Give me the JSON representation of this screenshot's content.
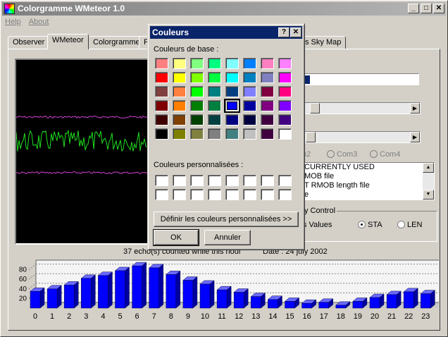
{
  "window": {
    "title": "Colorgramme WMeteor 1.0"
  },
  "menu": [
    "Help",
    "About"
  ],
  "tabs": [
    "Observer",
    "WMeteor",
    "Colorgramme",
    "F",
    "s Sky Map"
  ],
  "com_ports": [
    "m2",
    "Com3",
    "Com4"
  ],
  "listbox": {
    "lines": [
      "CURRENTLY USED",
      "MOB file",
      "T  RMOB length file",
      "e"
    ]
  },
  "display_control": {
    "legend": "y Control",
    "label": "s Values",
    "options": [
      "STA",
      "LEN"
    ],
    "selected": "STA"
  },
  "status": {
    "count_text": "37 echo(s) counted while this hour",
    "date_text": "Date : 24 july 2002"
  },
  "dialog": {
    "title": "Couleurs",
    "help_btn": "?",
    "close_btn": "✕",
    "basic_label": "Couleurs de base :",
    "custom_label": "Couleurs personnalisées :",
    "define_btn": "Définir les couleurs personnalisées >>",
    "ok_btn": "OK",
    "cancel_btn": "Annuler",
    "basic_colors": [
      "#ff8080",
      "#ffff80",
      "#80ff80",
      "#00ff80",
      "#80ffff",
      "#0080ff",
      "#ff80c0",
      "#ff80ff",
      "#ff0000",
      "#ffff00",
      "#80ff00",
      "#00ff40",
      "#00ffff",
      "#0080c0",
      "#8080c0",
      "#ff00ff",
      "#804040",
      "#ff8040",
      "#00ff00",
      "#008080",
      "#004080",
      "#8080ff",
      "#800040",
      "#ff0080",
      "#800000",
      "#ff8000",
      "#008000",
      "#008040",
      "#0000ff",
      "#0000a0",
      "#800080",
      "#8000ff",
      "#400000",
      "#804000",
      "#004000",
      "#004040",
      "#000080",
      "#000040",
      "#400040",
      "#400080",
      "#000000",
      "#808000",
      "#808040",
      "#808080",
      "#408080",
      "#c0c0c0",
      "#400040",
      "#ffffff"
    ],
    "selected_index": 28
  },
  "chart_data": {
    "type": "bar",
    "categories": [
      "0",
      "1",
      "2",
      "3",
      "4",
      "5",
      "6",
      "7",
      "8",
      "9",
      "10",
      "11",
      "12",
      "13",
      "14",
      "15",
      "16",
      "17",
      "18",
      "19",
      "20",
      "21",
      "22",
      "23"
    ],
    "values": [
      35,
      40,
      48,
      62,
      68,
      78,
      88,
      84,
      70,
      58,
      50,
      38,
      33,
      24,
      18,
      14,
      10,
      12,
      6,
      14,
      22,
      28,
      34,
      30
    ],
    "y_ticks": [
      20,
      40,
      60,
      80
    ],
    "ylim": [
      0,
      100
    ],
    "color": "#0000ff"
  }
}
